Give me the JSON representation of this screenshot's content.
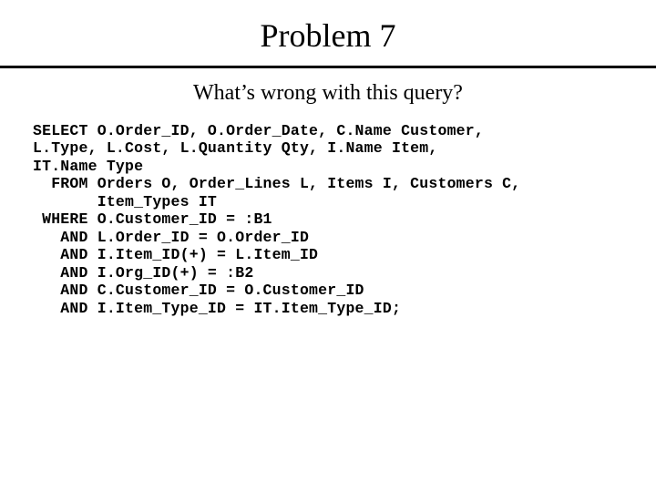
{
  "title": "Problem 7",
  "subtitle": "What’s wrong with this query?",
  "code": "SELECT O.Order_ID, O.Order_Date, C.Name Customer,\nL.Type, L.Cost, L.Quantity Qty, I.Name Item,\nIT.Name Type\n  FROM Orders O, Order_Lines L, Items I, Customers C,\n       Item_Types IT\n WHERE O.Customer_ID = :B1\n   AND L.Order_ID = O.Order_ID\n   AND I.Item_ID(+) = L.Item_ID\n   AND I.Org_ID(+) = :B2\n   AND C.Customer_ID = O.Customer_ID\n   AND I.Item_Type_ID = IT.Item_Type_ID;"
}
